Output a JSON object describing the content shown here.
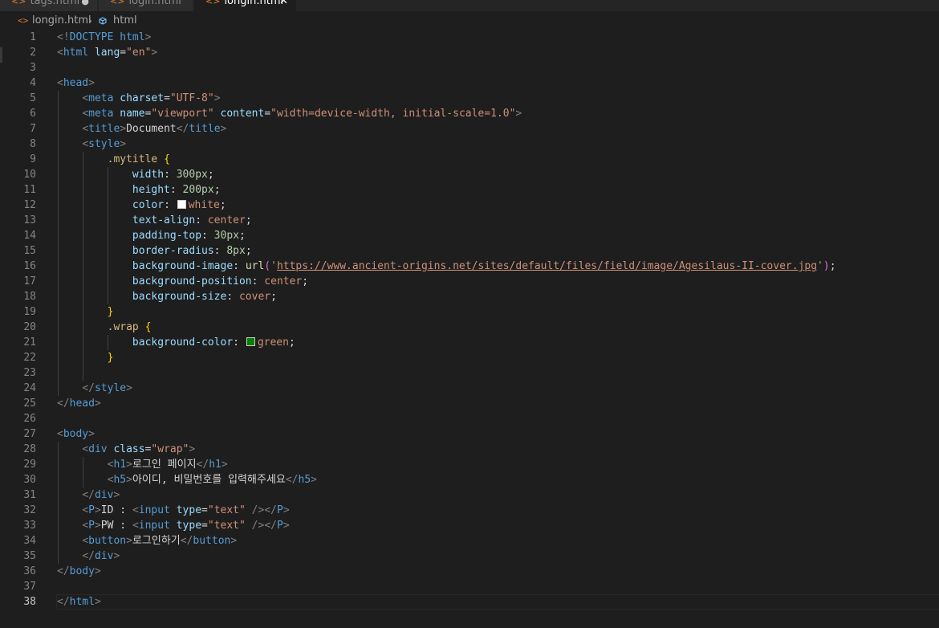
{
  "tabs": [
    {
      "icon": "<>",
      "label": "tags.html",
      "modified": "●",
      "active": false
    },
    {
      "icon": "<>",
      "label": "login.html",
      "active": false
    },
    {
      "icon": "<>",
      "label": "longin.html",
      "close": "✕",
      "active": true
    }
  ],
  "breadcrumb": {
    "file_icon": "<>",
    "file": "longin.html",
    "separator": "›",
    "element": "html"
  },
  "editor": {
    "active_line": 38,
    "colors": {
      "white_swatch": "#ffffff",
      "green_swatch": "#008000"
    },
    "lines": [
      {
        "n": "1",
        "code": "<!DOCTYPE html>"
      },
      {
        "n": "2",
        "code": "<html lang=\"en\">"
      },
      {
        "n": "3",
        "code": ""
      },
      {
        "n": "4",
        "code": "<head>"
      },
      {
        "n": "5",
        "code": "    <meta charset=\"UTF-8\">"
      },
      {
        "n": "6",
        "code": "    <meta name=\"viewport\" content=\"width=device-width, initial-scale=1.0\">"
      },
      {
        "n": "7",
        "code": "    <title>Document</title>"
      },
      {
        "n": "8",
        "code": "    <style>"
      },
      {
        "n": "9",
        "code": "        .mytitle {"
      },
      {
        "n": "10",
        "code": "            width: 300px;"
      },
      {
        "n": "11",
        "code": "            height: 200px;"
      },
      {
        "n": "12",
        "code": "            color: white;"
      },
      {
        "n": "13",
        "code": "            text-align: center;"
      },
      {
        "n": "14",
        "code": "            padding-top: 30px;"
      },
      {
        "n": "15",
        "code": "            border-radius: 8px;"
      },
      {
        "n": "16",
        "code": "            background-image: url('https://www.ancient-origins.net/sites/default/files/field/image/Agesilaus-II-cover.jpg');"
      },
      {
        "n": "17",
        "code": "            background-position: center;"
      },
      {
        "n": "18",
        "code": "            background-size: cover;"
      },
      {
        "n": "19",
        "code": "        }"
      },
      {
        "n": "20",
        "code": "        .wrap {"
      },
      {
        "n": "21",
        "code": "            background-color: green;"
      },
      {
        "n": "22",
        "code": "        }"
      },
      {
        "n": "23",
        "code": ""
      },
      {
        "n": "24",
        "code": "    </style>"
      },
      {
        "n": "25",
        "code": "</head>"
      },
      {
        "n": "26",
        "code": ""
      },
      {
        "n": "27",
        "code": "<body>"
      },
      {
        "n": "28",
        "code": "    <div class=\"wrap\">"
      },
      {
        "n": "29",
        "code": "        <h1>로그인 페이지</h1>"
      },
      {
        "n": "30",
        "code": "        <h5>아이디, 비밀번호를 입력해주세요</h5>"
      },
      {
        "n": "31",
        "code": "    </div>"
      },
      {
        "n": "32",
        "code": "    <P>ID : <input type=\"text\" /></P>"
      },
      {
        "n": "33",
        "code": "    <P>PW : <input type=\"text\" /></P>"
      },
      {
        "n": "34",
        "code": "    <button>로그인하기</button>"
      },
      {
        "n": "35",
        "code": "    </div>"
      },
      {
        "n": "36",
        "code": "</body>"
      },
      {
        "n": "37",
        "code": ""
      },
      {
        "n": "38",
        "code": "</html>"
      }
    ]
  }
}
